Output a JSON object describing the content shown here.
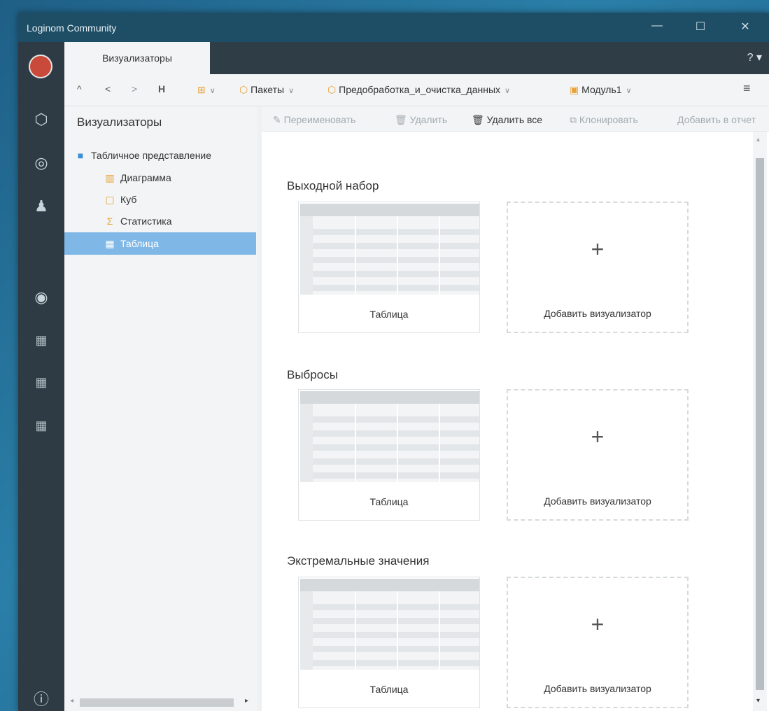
{
  "window": {
    "title": "Loginom Community",
    "minimize_icon": "—",
    "maximize_icon": "☐",
    "close_icon": "✕"
  },
  "tabs": [
    {
      "label": "Визуализаторы"
    }
  ],
  "help_icon": "?",
  "toolbar": {
    "up": "^",
    "back": "<",
    "forward": ">",
    "save": "H",
    "breadcrumbs": [
      {
        "label": "Пакеты"
      },
      {
        "label": "Предобработка_и_очистка_данных"
      },
      {
        "label": "Модуль1"
      }
    ],
    "menu_icon": "≡"
  },
  "left_panel": {
    "title": "Визуализаторы",
    "tree": {
      "root": "Табличное представление",
      "children": [
        {
          "label": "Диаграмма"
        },
        {
          "label": "Куб"
        },
        {
          "label": "Статистика"
        },
        {
          "label": "Таблица"
        }
      ]
    }
  },
  "actions": {
    "rename": "Переименовать",
    "delete": "Удалить",
    "delete_all": "Удалить все",
    "clone": "Клонировать",
    "add_report": "Добавить в отчет"
  },
  "sections": [
    {
      "title": "Выходной набор",
      "card_label": "Таблица",
      "add_label": "Добавить визуализатор"
    },
    {
      "title": "Выбросы",
      "card_label": "Таблица",
      "add_label": "Добавить визуализатор"
    },
    {
      "title": "Экстремальные значения",
      "card_label": "Таблица",
      "add_label": "Добавить визуализатор"
    }
  ],
  "add_plus": "+",
  "colors": {
    "titlebar": "#1e4e66",
    "rail": "#2e3b44",
    "selected": "#7fb7e6",
    "accent_orange": "#e8a33a"
  }
}
